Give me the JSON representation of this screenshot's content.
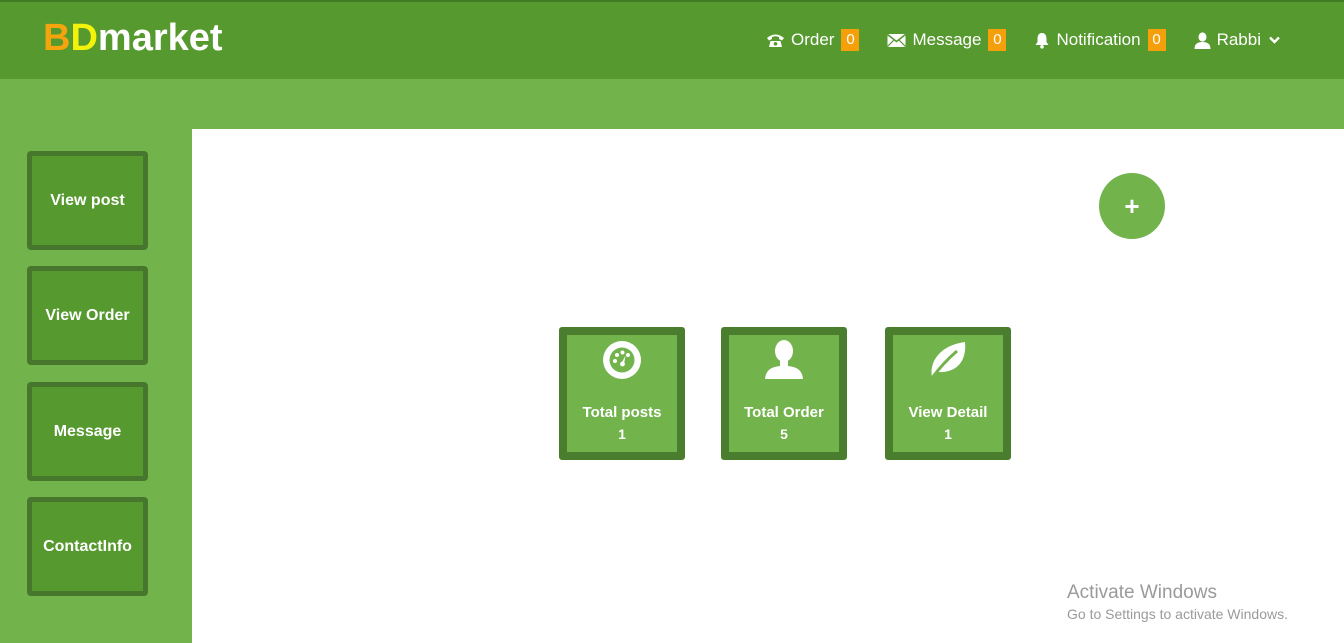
{
  "brand": {
    "part1": "B",
    "part2": "D",
    "part3": "market"
  },
  "header": {
    "order": {
      "label": "Order",
      "count": "0",
      "icon": "phone-icon"
    },
    "message": {
      "label": "Message",
      "count": "0",
      "icon": "envelope-icon"
    },
    "notification": {
      "label": "Notification",
      "count": "0",
      "icon": "bell-icon"
    },
    "user": {
      "name": "Rabbi",
      "icon": "user-icon",
      "dropdown_icon": "chevron-down-icon"
    }
  },
  "sidebar": {
    "items": [
      {
        "label": "View post"
      },
      {
        "label": "View Order"
      },
      {
        "label": "Message"
      },
      {
        "label": "ContactInfo"
      }
    ]
  },
  "main": {
    "add_button": "+",
    "cards": [
      {
        "label": "Total posts",
        "value": "1",
        "icon": "dashboard-icon"
      },
      {
        "label": "Total Order",
        "value": "5",
        "icon": "user-icon"
      },
      {
        "label": "View Detail",
        "value": "1",
        "icon": "leaf-icon"
      }
    ]
  },
  "watermark": {
    "line1": "Activate Windows",
    "line2": "Go to Settings to activate Windows."
  },
  "colors": {
    "header": "#56992f",
    "accent": "#72b34c",
    "border": "#4a7d2e",
    "badge": "#f5a00a",
    "brand_b": "#f5a40e",
    "brand_d": "#f2f20a"
  }
}
